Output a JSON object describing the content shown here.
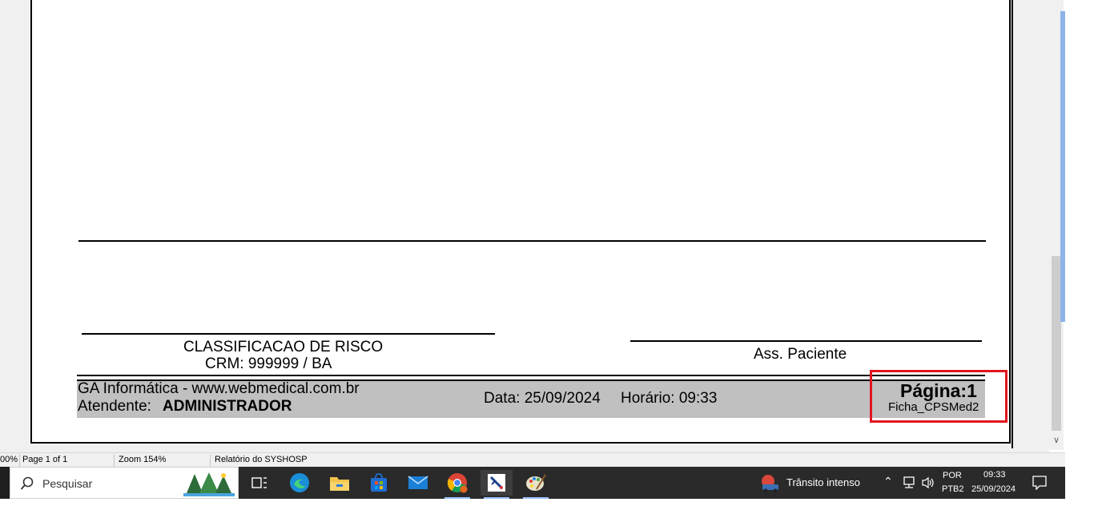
{
  "report": {
    "signature_left_title": "CLASSIFICACAO DE RISCO",
    "signature_left_crm": "CRM: 999999 / BA",
    "signature_right": "Ass. Paciente",
    "footer_company": "GA Informática - www.webmedical.com.br",
    "footer_attendant_label": "Atendente:",
    "footer_attendant_value": "ADMINISTRADOR",
    "footer_date": "Data: 25/09/2024",
    "footer_time": "Horário: 09:33",
    "footer_page": "Página:1",
    "footer_form": "Ficha_CPSMed2"
  },
  "statusbar": {
    "zoom_cut": "00%",
    "page_info": "Page 1 of 1",
    "zoom": "Zoom 154%",
    "report_name": "Relatório do SYSHOSP"
  },
  "taskbar": {
    "search_placeholder": "Pesquisar",
    "weather_text": "Trânsito intenso",
    "language_top": "POR",
    "language_bottom": "PTB2",
    "clock_time": "09:33",
    "clock_date": "25/09/2024",
    "apps": [
      "task-view",
      "edge",
      "file-explorer",
      "microsoft-store",
      "mail",
      "chrome",
      "syshosp",
      "paint"
    ]
  },
  "colors": {
    "highlight": "#e0161e",
    "footer_band": "#c0c0c0",
    "taskbar": "#2a2a2a"
  }
}
